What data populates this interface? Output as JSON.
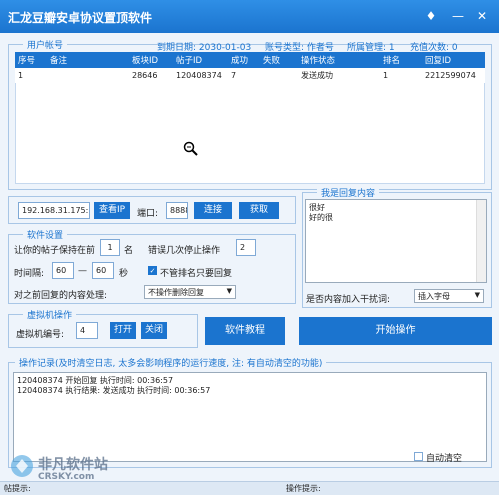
{
  "window": {
    "title": "汇龙豆瓣安卓协议置顶软件"
  },
  "account_group": {
    "legend": "用户帐号",
    "expiry": "到期日期: 2030-01-03",
    "account_type": "账号类型: 作者号",
    "manager": "所属管理: 1",
    "recharge": "充值次数: 0"
  },
  "table": {
    "columns": [
      "序号",
      "备注",
      "板块ID",
      "帖子ID",
      "成功",
      "失败",
      "操作状态",
      "排名",
      "回复ID"
    ],
    "rows": [
      [
        "1",
        "",
        "28646",
        "120408374",
        "7",
        "",
        "发送成功",
        "1",
        "2212599074"
      ]
    ]
  },
  "proxy": {
    "ip": "192.168.31.175:",
    "view_ip": "查看IP",
    "port_label": "端口:",
    "port": "8888",
    "connect": "连接",
    "fetch": "获取"
  },
  "settings": {
    "legend": "软件设置",
    "keep_prefix": "让你的帖子保持在前",
    "keep_value": "1",
    "keep_suffix": "名",
    "errors_label": "错误几次停止操作",
    "errors_value": "2",
    "interval_label": "时间隔:",
    "interval_from": "60",
    "dash": "—",
    "interval_to": "60",
    "seconds": "秒",
    "ignore_rank": "不管排名只要回复",
    "prev_label": "对之前回复的内容处理:",
    "prev_value": "不操作删除回复"
  },
  "vm": {
    "legend": "虚拟机操作",
    "number_label": "虚拟机编号:",
    "number": "4",
    "open": "打开",
    "close": "关闭"
  },
  "buttons": {
    "tutorial": "软件教程",
    "start": "开始操作"
  },
  "reply": {
    "legend": "我是回复内容",
    "lines": [
      "很好",
      "好的很"
    ],
    "disturb_label": "是否内容加入干扰词:",
    "disturb_value": "插入字母"
  },
  "log": {
    "legend": "操作记录(及时清空日志, 太多会影响程序的运行速度, 注: 有自动清空的功能)",
    "lines": [
      "120408374    开始回复 执行时间: 00:36:57",
      "120408374    执行结果: 发送成功 执行时间: 00:36:57"
    ],
    "auto_clear": "自动清空"
  },
  "status": {
    "left": "帖提示:",
    "right": "操作提示:"
  },
  "watermark": {
    "cn": "非凡软件站",
    "en": "CRSKY.com"
  },
  "colors": {
    "accent": "#1b74cf",
    "title_bar": "#2f8fe6"
  }
}
